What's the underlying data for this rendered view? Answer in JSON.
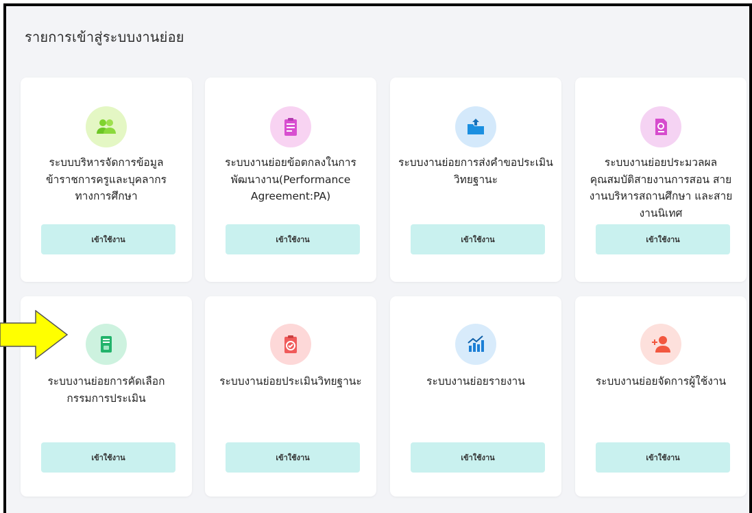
{
  "page": {
    "title": "รายการเข้าสู่ระบบงานย่อย"
  },
  "cards": [
    {
      "label": "ระบบบริหารจัดการข้อมูลข้าราชการครูและบุคลากรทางการศึกษา",
      "button": "เข้าใช้งาน",
      "icon": "users-icon",
      "icon_bg": "#e4f7c4"
    },
    {
      "label": "ระบบงานย่อยข้อตกลงในการพัฒนางาน(Performance Agreement:PA)",
      "button": "เข้าใช้งาน",
      "icon": "clipboard-pa-icon",
      "icon_bg": "#f8d3f2"
    },
    {
      "label": "ระบบงานย่อยการส่งคำขอประเมินวิทยฐานะ",
      "button": "เข้าใช้งาน",
      "icon": "folder-upload-icon",
      "icon_bg": "#d4e9fb"
    },
    {
      "label": "ระบบงานย่อยประมวลผลคุณสมบัติสายงานการสอน สายงานบริหารสถานศึกษา และสายงานนิเทศ",
      "button": "เข้าใช้งาน",
      "icon": "document-search-icon",
      "icon_bg": "#f5d3f3"
    },
    {
      "label": "ระบบงานย่อยการคัดเลือกกรรมการประเมิน",
      "button": "เข้าใช้งาน",
      "icon": "id-card-icon",
      "icon_bg": "#cdf2df"
    },
    {
      "label": "ระบบงานย่อยประเมินวิทยฐานะ",
      "button": "เข้าใช้งาน",
      "icon": "clipboard-check-icon",
      "icon_bg": "#fdd8d8"
    },
    {
      "label": "ระบบงานย่อยรายงาน",
      "button": "เข้าใช้งาน",
      "icon": "bar-chart-icon",
      "icon_bg": "#d8ebfb"
    },
    {
      "label": "ระบบงานย่อยจัดการผู้ใช้งาน",
      "button": "เข้าใช้งาน",
      "icon": "add-user-icon",
      "icon_bg": "#fde0dc"
    }
  ],
  "colors": {
    "button_bg": "#c9f1ef",
    "page_bg": "#f3f4f7",
    "arrow_fill": "#ffff00"
  }
}
